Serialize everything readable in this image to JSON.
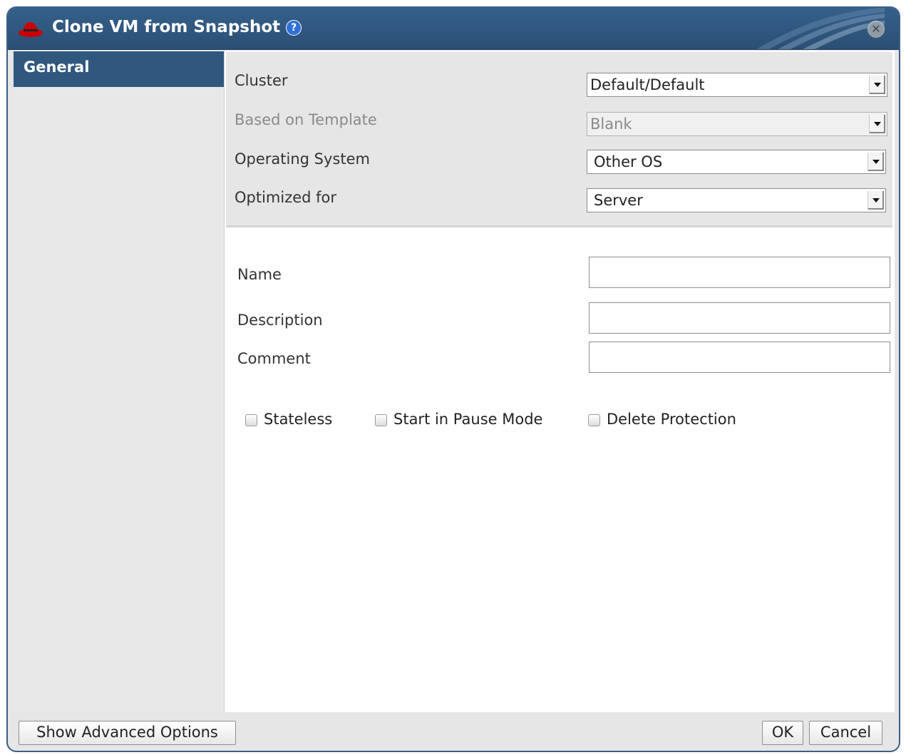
{
  "dialog": {
    "title": "Clone VM from Snapshot",
    "help_icon": "help-icon",
    "close_icon": "close-icon",
    "logo_icon": "redhat-hat-icon"
  },
  "sidebar": {
    "tabs": [
      {
        "label": "General"
      }
    ]
  },
  "general": {
    "cluster": {
      "label": "Cluster",
      "value": "Default/Default"
    },
    "template": {
      "label": "Based on Template",
      "value": "Blank"
    },
    "os": {
      "label": "Operating System",
      "value": "Other OS"
    },
    "optimized": {
      "label": "Optimized for",
      "value": "Server"
    },
    "name": {
      "label": "Name",
      "value": ""
    },
    "description": {
      "label": "Description",
      "value": ""
    },
    "comment": {
      "label": "Comment",
      "value": ""
    },
    "checkboxes": {
      "stateless": "Stateless",
      "pause": "Start in Pause Mode",
      "protection": "Delete Protection"
    }
  },
  "footer": {
    "advanced": "Show Advanced Options",
    "ok": "OK",
    "cancel": "Cancel"
  },
  "colors": {
    "titlebar": "#2f5880",
    "selected_tab": "#30587f",
    "panel_bg": "#e6e6e6"
  }
}
